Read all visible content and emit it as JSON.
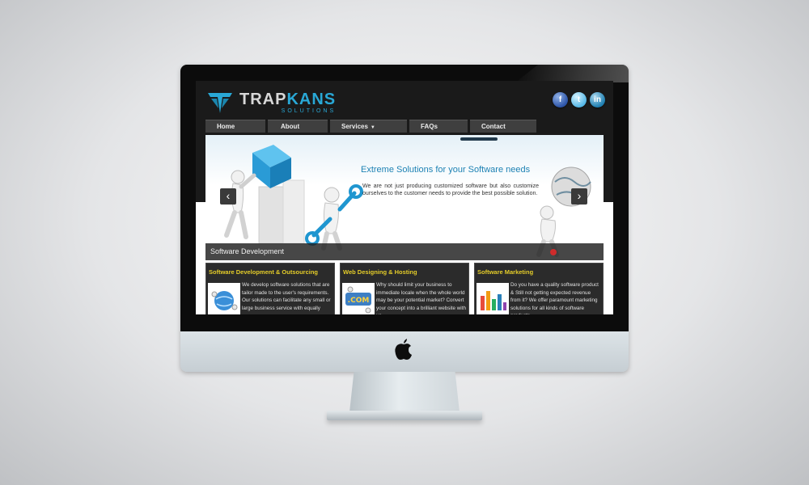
{
  "brand": {
    "name_part1": "TRAP",
    "name_part2": "KANS",
    "subtitle": "SOLUTIONS"
  },
  "social": [
    {
      "icon": "facebook-icon",
      "glyph": "f"
    },
    {
      "icon": "twitter-icon",
      "glyph": "t"
    },
    {
      "icon": "linkedin-icon",
      "glyph": "in"
    }
  ],
  "nav": {
    "items": [
      {
        "label": "Home"
      },
      {
        "label": "About"
      },
      {
        "label": "Services",
        "dropdown": true
      },
      {
        "label": "FAQs"
      },
      {
        "label": "Contact"
      }
    ]
  },
  "slider": {
    "heading": "Extreme Solutions for your Software needs",
    "text": "We are not just producing customized software but also customize ourselves to the customer needs to provide the best possible solution.",
    "caption": "Software Development",
    "prev_label": "‹",
    "next_label": "›"
  },
  "services": [
    {
      "title": "Software Development & Outsourcing",
      "text": "We develop software solutions that are tailor made to the user's requirements. Our solutions can facilitate any small or large business service with equally"
    },
    {
      "title": "Web Designing & Hosting",
      "text": "Why should limit your business to immediate locale when the whole world may be your potential market? Convert your concept into a brilliant website with us"
    },
    {
      "title": "Software Marketing",
      "text": "Do you have a quality software product & Still not getting expected revenue from it? We offer paramount marketing solutions for all kinds of software products"
    }
  ],
  "colors": {
    "accent_blue": "#29a8d6",
    "service_title": "#e4cc29",
    "slider_dot": "#cf2b2b"
  }
}
